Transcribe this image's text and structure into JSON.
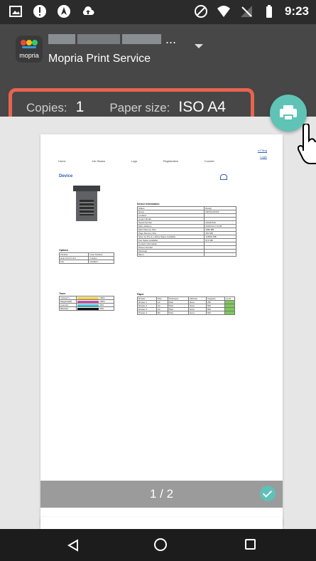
{
  "status_bar": {
    "time": "9:23",
    "left_icons": [
      "image-icon",
      "alert-icon",
      "nav-icon",
      "cloud-icon"
    ],
    "right_icons": [
      "do-not-disturb-icon",
      "wifi-icon",
      "no-sim-icon",
      "battery-icon"
    ]
  },
  "app": {
    "logo_text": "mopria",
    "service_name": "Mopria Print Service",
    "printer_name_suffix": "..."
  },
  "options": {
    "copies_label": "Copies:",
    "copies_value": "1",
    "paper_label": "Paper size:",
    "paper_value": "ISO A4"
  },
  "preview": {
    "page_indicator": "1 / 2"
  },
  "document": {
    "nav": [
      "Home",
      "Job Status",
      "Logs",
      "Registration",
      "Counter"
    ],
    "efiling": "e-Filing",
    "login": "Login",
    "title": "Device",
    "device_info_title": "Device Information",
    "device_info": [
      [
        "Status",
        "Ready"
      ],
      [
        "Name",
        "MFP11122333"
      ],
      [
        "Location",
        ""
      ],
      [
        "Copier Model",
        ""
      ],
      [
        "Serial Number",
        "CFH07410"
      ],
      [
        "MAC Address",
        "00:80:91:c7:fe:80"
      ],
      [
        "Main Memory Size",
        "4096 MB"
      ],
      [
        "Page Memory Size",
        "452 MB"
      ],
      [
        "Save as File & e-Filing Space Available",
        "123840 MB"
      ],
      [
        "Fax Space Available",
        "974 MB"
      ],
      [
        "Contact Information",
        ""
      ],
      [
        "Phone Number",
        ""
      ],
      [
        "Message",
        ""
      ],
      [
        "Menu",
        ""
      ]
    ],
    "options_title": "Options",
    "options_rows": [
      [
        "Finisher",
        "Inner Finisher"
      ],
      [
        "Hole Punch Unit",
        "2 Holes"
      ],
      [
        "Fax",
        "Installed"
      ]
    ],
    "toner_title": "Toner",
    "toner_rows": [
      [
        "Yellow(Y)",
        "100%"
      ],
      [
        "Magenta(M)",
        "100%"
      ],
      [
        "Cyan(C)",
        "99%"
      ],
      [
        "Black(K)",
        "99%"
      ]
    ],
    "paper_title": "Paper",
    "paper_header": [
      "Drawer",
      "Size",
      "Thickness",
      "Attribute",
      "Capacity",
      "Level"
    ],
    "paper_rows": [
      [
        "Drawer 1",
        "A4",
        "Plain",
        "None",
        "250"
      ],
      [
        "Drawer 2",
        "A4",
        "Plain",
        "None",
        "500"
      ],
      [
        "Drawer 3",
        "A3",
        "Plain",
        "None",
        "500"
      ],
      [
        "Drawer 4",
        "B4",
        "Plain",
        "None",
        "500"
      ]
    ]
  },
  "colors": {
    "accent_teal": "#5fc3b6",
    "highlight_border": "#e8644f",
    "header_bg": "#474747"
  }
}
